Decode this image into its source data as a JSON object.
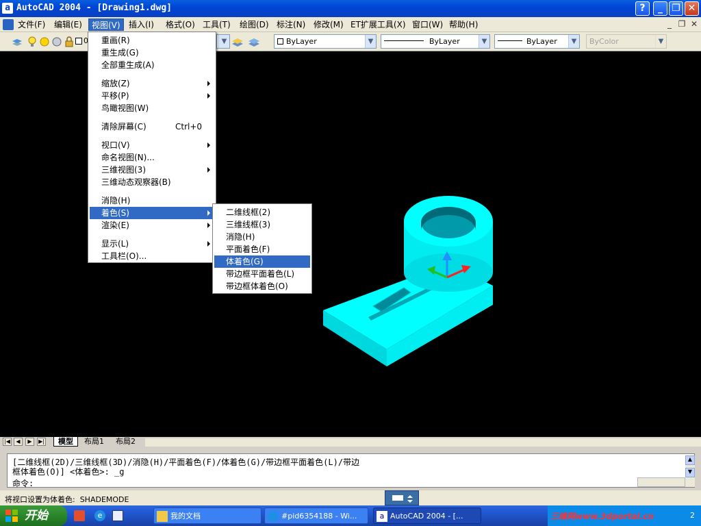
{
  "window": {
    "title": "AutoCAD 2004 - [Drawing1.dwg]",
    "app_icon_glyph": "a",
    "help_glyph": "?",
    "minimize_glyph": "_",
    "maximize_glyph": "❐",
    "close_glyph": "✕"
  },
  "menubar": {
    "items": [
      "文件(F)",
      "编辑(E)",
      "视图(V)",
      "插入(I)",
      "格式(O)",
      "工具(T)",
      "绘图(D)",
      "标注(N)",
      "修改(M)",
      "ET扩展工具(X)",
      "窗口(W)",
      "帮助(H)"
    ],
    "active": "视图(V)",
    "mdi_minimize": "_",
    "mdi_restore": "❐",
    "mdi_close": "✕"
  },
  "toolbar": {
    "layer_value": "0",
    "color_combo": "ByLayer",
    "linetype_combo": "ByLayer",
    "lineweight_combo": "ByLayer",
    "plotstyle_combo": "ByColor"
  },
  "view_menu": {
    "items": [
      {
        "label": "重画(R)"
      },
      {
        "label": "重生成(G)"
      },
      {
        "label": "全部重生成(A)"
      },
      {
        "label": "缩放(Z)",
        "submenu": true
      },
      {
        "label": "平移(P)",
        "submenu": true
      },
      {
        "label": "鸟瞰视图(W)"
      },
      {
        "label": "清除屏幕(C)",
        "shortcut": "Ctrl+0"
      },
      {
        "label": "视口(V)",
        "submenu": true
      },
      {
        "label": "命名视图(N)..."
      },
      {
        "label": "三维视图(3)",
        "submenu": true
      },
      {
        "label": "三维动态观察器(B)"
      },
      {
        "label": "消隐(H)"
      },
      {
        "label": "着色(S)",
        "submenu": true,
        "highlighted": true
      },
      {
        "label": "渲染(E)",
        "submenu": true
      },
      {
        "label": "显示(L)",
        "submenu": true
      },
      {
        "label": "工具栏(O)..."
      }
    ]
  },
  "shade_submenu": {
    "items": [
      {
        "label": "二维线框(2)"
      },
      {
        "label": "三维线框(3)"
      },
      {
        "label": "消隐(H)"
      },
      {
        "label": "平面着色(F)"
      },
      {
        "label": "体着色(G)",
        "highlighted": true
      },
      {
        "label": "带边框平面着色(L)"
      },
      {
        "label": "带边框体着色(O)"
      }
    ]
  },
  "model": {
    "color": "#00ffff",
    "edge_color": "#00c8d0"
  },
  "ucs": {
    "x_color": "#ff2020",
    "y_color": "#20c020",
    "z_color": "#2090ff"
  },
  "tabs": {
    "items": [
      "模型",
      "布局1",
      "布局2"
    ],
    "active": "模型"
  },
  "command": {
    "line1": "[二维线框(2D)/三维线框(3D)/消隐(H)/平面着色(F)/体着色(G)/带边框平面着色(L)/带边",
    "line2": "框体着色(O)] <体着色>: _g",
    "prompt": "命令:"
  },
  "status": {
    "text": "将视口设置为体着色:  SHADEMODE"
  },
  "taskbar": {
    "start_label": "开始",
    "buttons": [
      {
        "label": "我的文档"
      },
      {
        "label": "#pid6354188 - Wi..."
      },
      {
        "label": "AutoCAD 2004 - [..."
      }
    ],
    "watermark": "三维网www.3dportal.cn",
    "clock": "2"
  }
}
